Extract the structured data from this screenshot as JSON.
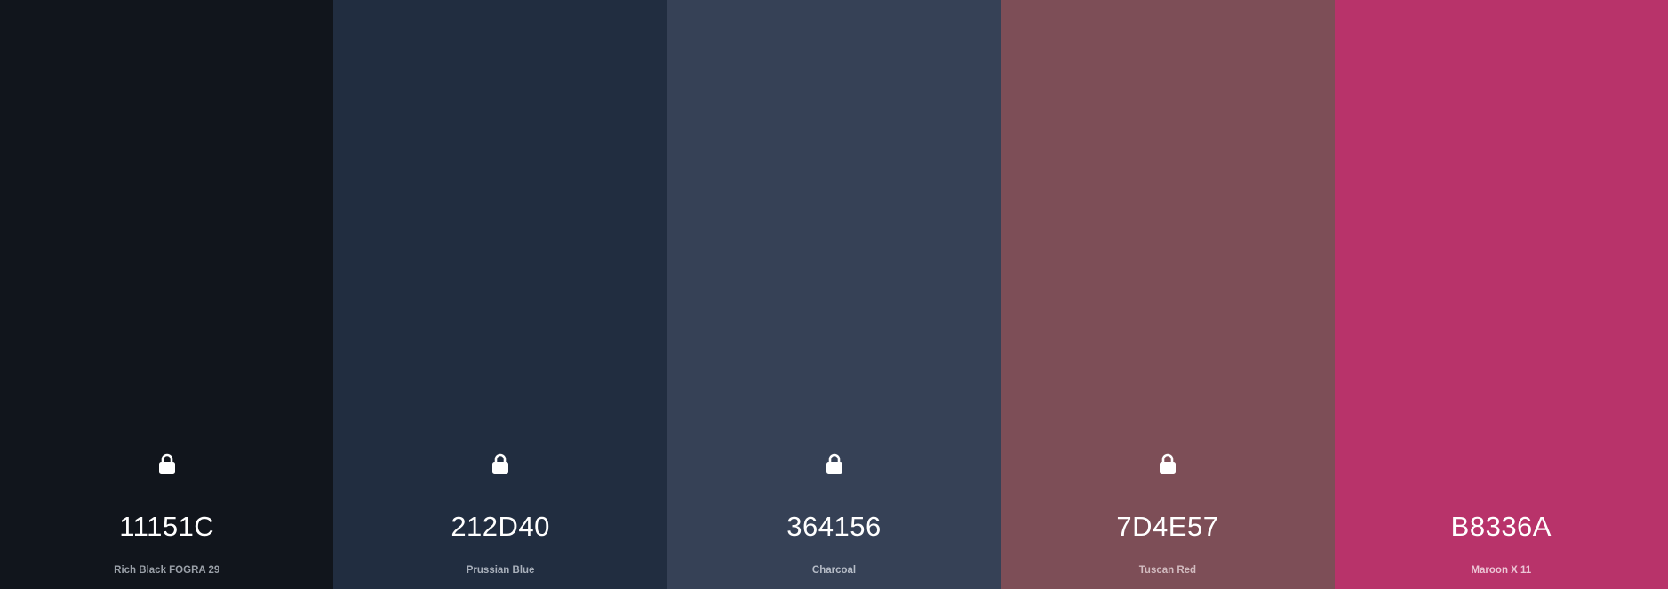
{
  "palette": {
    "swatches": [
      {
        "hex": "11151C",
        "name": "Rich Black FOGRA 29",
        "color": "#11151C",
        "name_color": "#9aa0a8",
        "locked": true
      },
      {
        "hex": "212D40",
        "name": "Prussian Blue",
        "color": "#212D40",
        "name_color": "#a9b0bb",
        "locked": true
      },
      {
        "hex": "364156",
        "name": "Charcoal",
        "color": "#364156",
        "name_color": "#b6bcc7",
        "locked": true
      },
      {
        "hex": "7D4E57",
        "name": "Tuscan Red",
        "color": "#7D4E57",
        "name_color": "#d2bcc0",
        "locked": true
      },
      {
        "hex": "B8336A",
        "name": "Maroon X 11",
        "color": "#B8336A",
        "name_color": "#ecc6d6",
        "locked": false
      }
    ],
    "icons": {
      "lock": "lock-icon"
    }
  }
}
